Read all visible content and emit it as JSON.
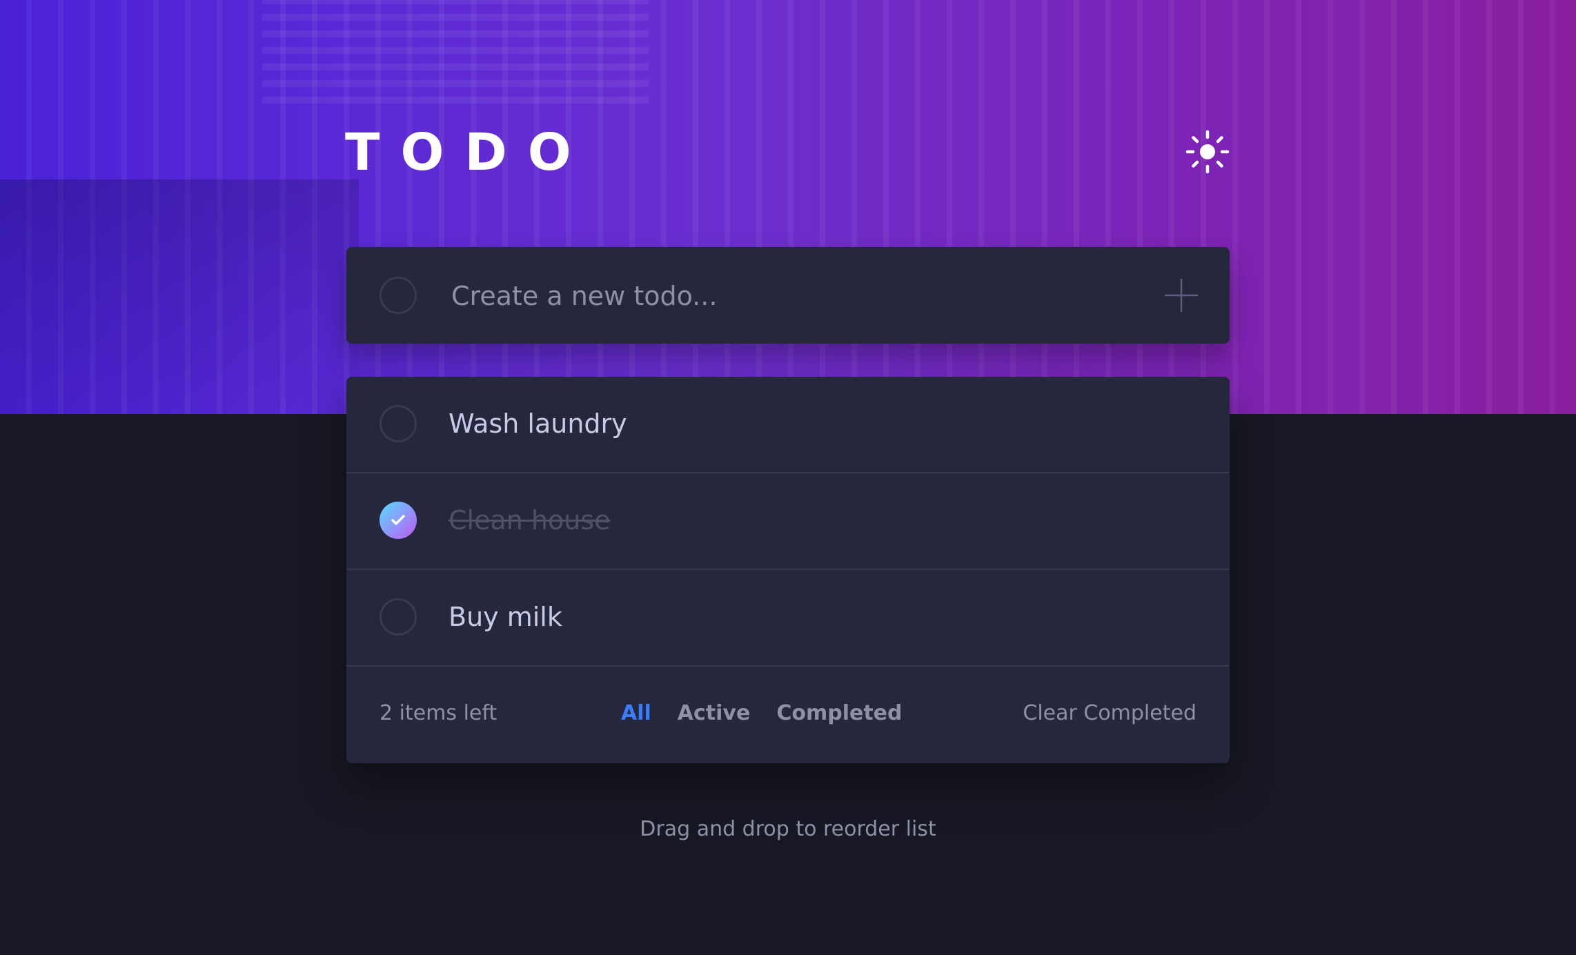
{
  "header": {
    "title": "TODO",
    "theme_icon": "sun-icon"
  },
  "new_todo": {
    "placeholder": "Create a new todo...",
    "add_icon": "plus-icon"
  },
  "todos": [
    {
      "text": "Wash laundry",
      "completed": false
    },
    {
      "text": "Clean house",
      "completed": true
    },
    {
      "text": "Buy milk",
      "completed": false
    }
  ],
  "footer": {
    "items_left": "2 items left",
    "filters": [
      {
        "label": "All",
        "active": true
      },
      {
        "label": "Active",
        "active": false
      },
      {
        "label": "Completed",
        "active": false
      }
    ],
    "clear_completed": "Clear Completed"
  },
  "hint": "Drag and drop to reorder list",
  "colors": {
    "accent": "#3a7cfd",
    "check_gradient_start": "#57ddff",
    "check_gradient_end": "#c058f3",
    "card": "#25273c",
    "background": "#181824"
  }
}
